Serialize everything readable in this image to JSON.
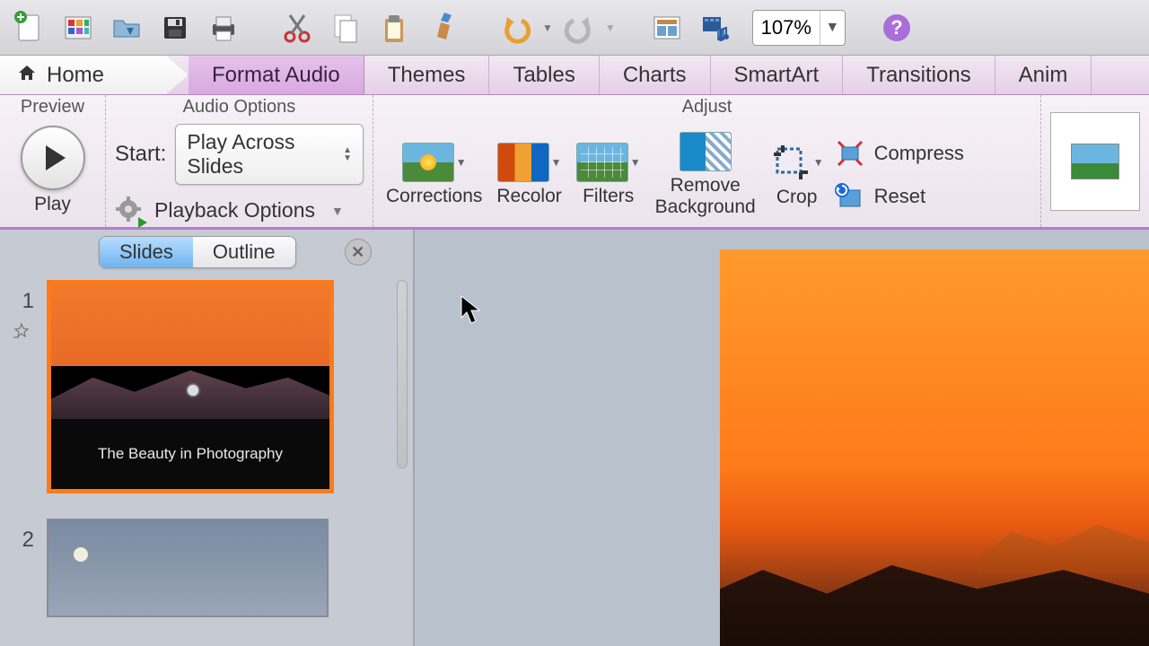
{
  "toolbar": {
    "zoom_value": "107%"
  },
  "tabs": {
    "home": "Home",
    "active": "Format Audio",
    "items": [
      "Themes",
      "Tables",
      "Charts",
      "SmartArt",
      "Transitions",
      "Anim"
    ]
  },
  "ribbon": {
    "preview": {
      "title": "Preview",
      "play": "Play"
    },
    "audio_options": {
      "title": "Audio Options",
      "start_label": "Start:",
      "start_value": "Play Across Slides",
      "playback": "Playback Options"
    },
    "adjust": {
      "title": "Adjust",
      "corrections": "Corrections",
      "recolor": "Recolor",
      "filters": "Filters",
      "remove_bg": "Remove\nBackground",
      "crop": "Crop",
      "compress": "Compress",
      "reset": "Reset"
    }
  },
  "panel": {
    "slides_tab": "Slides",
    "outline_tab": "Outline",
    "slides": [
      {
        "num": "1",
        "title": "The Beauty in Photography"
      },
      {
        "num": "2",
        "title": ""
      }
    ]
  }
}
